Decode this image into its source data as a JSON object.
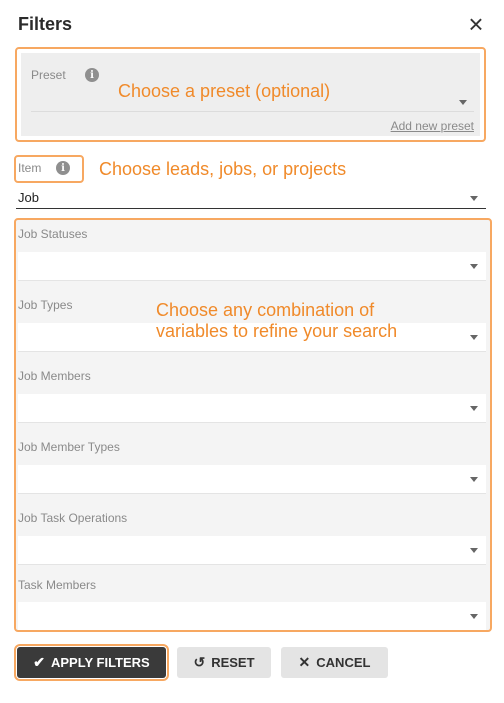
{
  "dialog": {
    "title": "Filters",
    "close_icon": "×"
  },
  "preset": {
    "label": "Preset",
    "add_new": "Add new preset",
    "annotation": "Choose a preset (optional)"
  },
  "item": {
    "label": "Item",
    "value": "Job",
    "annotation": "Choose leads, jobs, or projects"
  },
  "fields": {
    "annotation_line1": "Choose any combination of",
    "annotation_line2": "variables to refine your search",
    "items": [
      {
        "label": "Job Statuses"
      },
      {
        "label": "Job Types"
      },
      {
        "label": "Job Members"
      },
      {
        "label": "Job Member Types"
      },
      {
        "label": "Job Task Operations"
      },
      {
        "label": "Task Members"
      }
    ]
  },
  "buttons": {
    "apply": "APPLY FILTERS",
    "reset": "RESET",
    "cancel": "CANCEL"
  },
  "colors": {
    "annotation": "#f08a2a",
    "highlight_border": "#f7a861",
    "primary_button": "#3a3a3a"
  }
}
